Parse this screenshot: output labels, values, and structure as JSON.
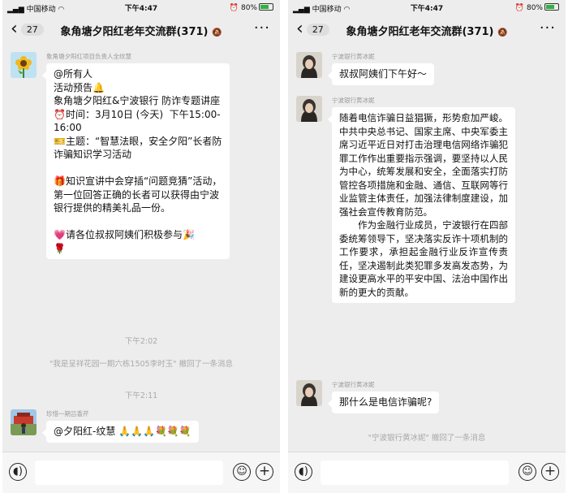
{
  "colors": {
    "chat_bg": "#ededed",
    "bubble_bg": "#ffffff",
    "system_text": "#a9a9a9"
  },
  "status_bar": {
    "left": {
      "carrier": "中国移动",
      "time": "下午4:47",
      "battery": "80%"
    },
    "right": {
      "carrier": "中国移动",
      "time": "下午4:47",
      "battery": "80%"
    }
  },
  "chat": {
    "back_count": "27",
    "title": "象角塘夕阳红老年交流群(371)",
    "mute_icon": "bell-off-icon"
  },
  "left_panel": {
    "messages": [
      {
        "sender": "象角塘夕阳红项目负责人全纹慧",
        "text": "@所有人\n活动预告🔔\n象角塘夕阳红&宁波银行 防诈专题讲座\n⏰时间：3月10日 (今天)  下午15:00-16:00\n🎫主题：“智慧法眼，安全夕阳”长者防诈骗知识学习活动\n\n🎁知识宣讲中会穿插“问题竞猜”活动，第一位回答正确的长者可以获得由宁波银行提供的精美礼品一份。\n\n💗请各位叔叔阿姨们积极参与🎉\n🌹"
      },
      {
        "sender": "珍惜一期吕香芹",
        "text": "@夕阳红-纹慧 🙏🙏🙏💐💐💐"
      }
    ],
    "system": [
      {
        "time": "下午2:02",
        "notice": "\"我是呈祥花园一期六栋1505李时玉\" 撤回了一条消息"
      },
      {
        "time": "下午2:11"
      }
    ]
  },
  "right_panel": {
    "messages": [
      {
        "sender": "宁波银行黄冰妮",
        "text": "叔叔阿姨们下午好～"
      },
      {
        "sender": "宁波银行黄冰妮",
        "text": "随着电信诈骗日益猖獗，形势愈加严峻。中共中央总书记、国家主席、中央军委主席习近平近日对打击治理电信网络诈骗犯罪工作作出重要指示强调，要坚持以人民为中心，统筹发展和安全，全面落实打防管控各项措施和金融、通信、互联网等行业监管主体责任，加强法律制度建设，加强社会宣传教育防范。\n　　作为金融行业成员，宁波银行在四部委统筹领导下，坚决落实反诈十项机制的工作要求，承担起金融行业反诈宣传责任，坚决遏制此类犯罪多发高发态势，为建设更高水平的平安中国、法治中国作出新的更大的贡献。"
      },
      {
        "sender": "宁波银行黄冰妮",
        "text": "那什么是电信诈骗呢?"
      }
    ],
    "system": [
      {
        "notice": "\"宁波银行黄冰妮\" 撤回了一条消息"
      }
    ]
  },
  "input_bar": {
    "voice_icon": "voice-icon",
    "emoji_icon": "emoji-icon",
    "plus_icon": "plus-icon"
  }
}
